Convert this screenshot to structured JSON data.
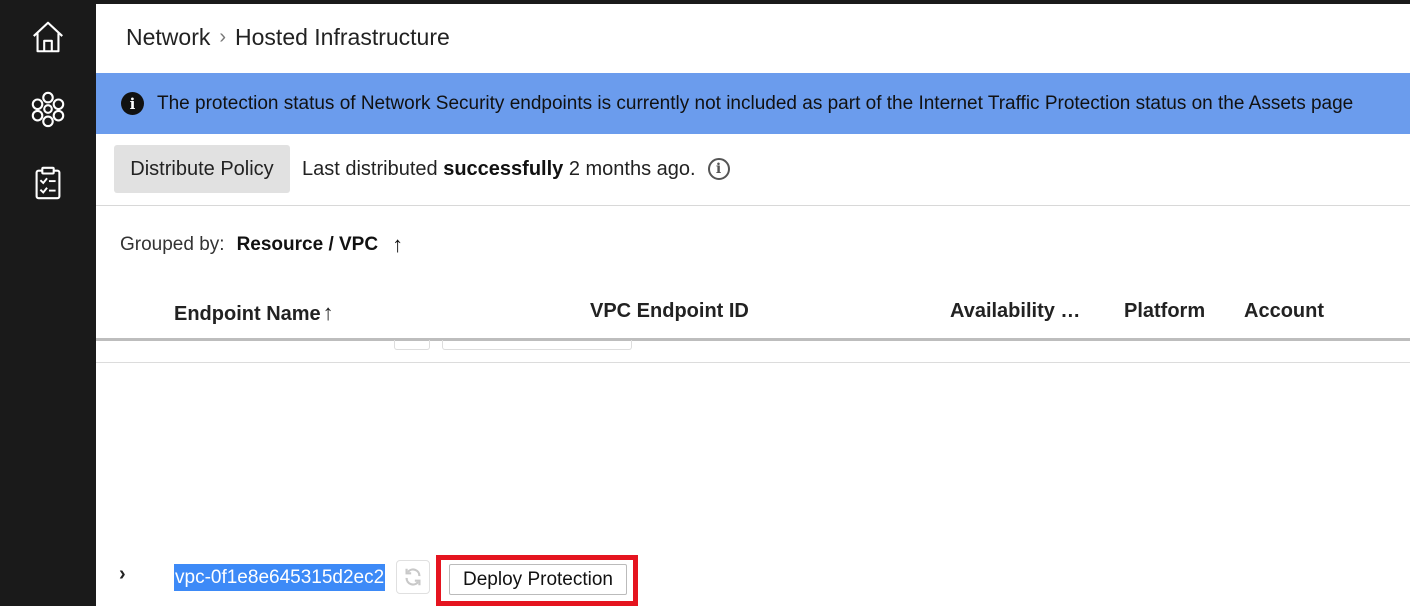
{
  "sidebar": {
    "items": [
      {
        "name": "home",
        "icon": "home-icon"
      },
      {
        "name": "network",
        "icon": "network-icon"
      },
      {
        "name": "tasks",
        "icon": "clipboard-check-icon"
      }
    ]
  },
  "breadcrumb": {
    "parent": "Network",
    "separator": "›",
    "current": "Hosted Infrastructure"
  },
  "banner": {
    "icon": "info-icon",
    "text": "The protection status of Network Security endpoints is currently not included as part of the Internet Traffic Protection status on the Assets page"
  },
  "toolbar": {
    "distribute_label": "Distribute Policy",
    "status_prefix": "Last distributed",
    "status_bold": "successfully",
    "status_suffix": "2 months ago."
  },
  "grouping": {
    "label": "Grouped by:",
    "value": "Resource / VPC",
    "sort_arrow": "↑"
  },
  "table": {
    "columns": [
      "Endpoint Name",
      "VPC Endpoint ID",
      "Availability …",
      "Platform",
      "Account"
    ],
    "sort_arrow": "↑",
    "rows": [
      {
        "expander": "›",
        "id": "vpc-0f1e8e645315d2ec2",
        "action_label": "Deploy Protection"
      }
    ]
  },
  "colors": {
    "sidebar": "#1a1a1a",
    "banner": "#6b9ced",
    "selection": "#3d8af7",
    "highlight": "#e5141f"
  }
}
